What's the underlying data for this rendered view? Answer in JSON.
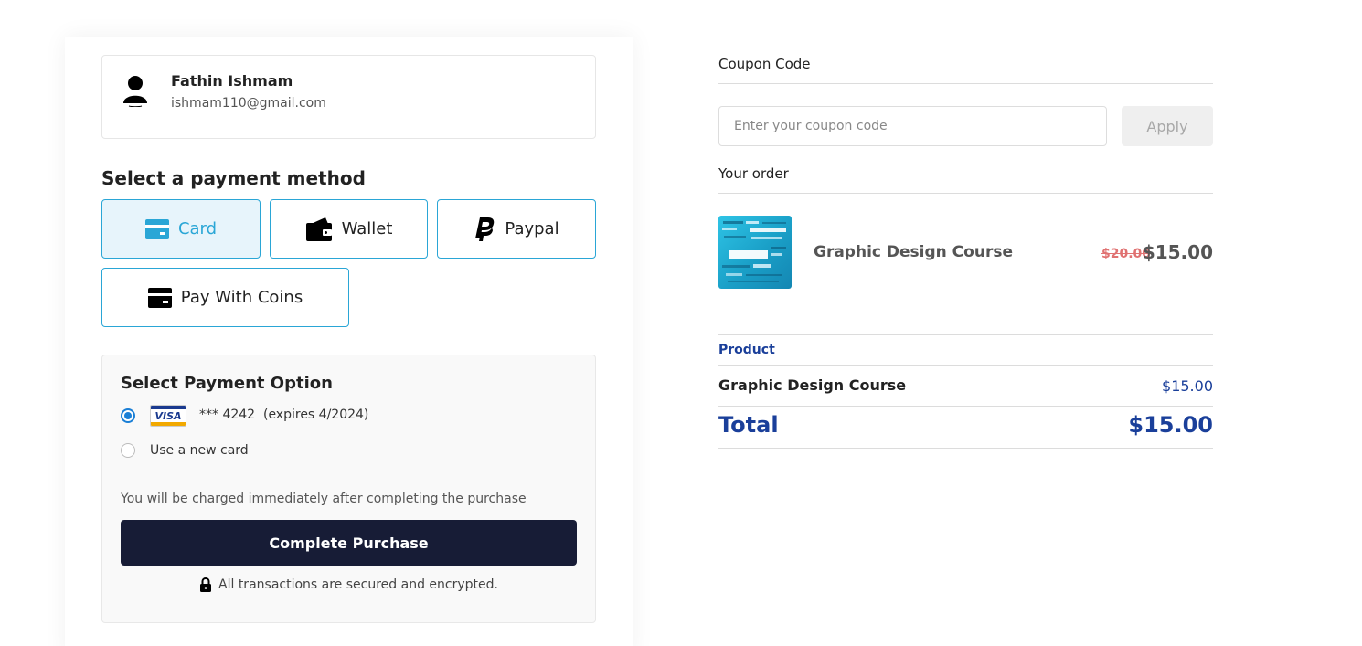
{
  "user": {
    "name": "Fathin Ishmam",
    "email": "ishmam110@gmail.com"
  },
  "payment_methods": {
    "title": "Select a payment method",
    "items": [
      {
        "label": "Card",
        "icon": "credit-card-icon",
        "active": true
      },
      {
        "label": "Wallet",
        "icon": "wallet-icon",
        "active": false
      },
      {
        "label": "Paypal",
        "icon": "paypal-icon",
        "active": false
      },
      {
        "label": "Pay With Coins",
        "icon": "coins-card-icon",
        "active": false
      }
    ]
  },
  "payment_option": {
    "title": "Select Payment Option",
    "saved_card": {
      "brand": "VISA",
      "info": "*** 4242  (expires 4/2024)",
      "selected": true
    },
    "new_card_label": "Use a new card",
    "charge_note": "You will be charged immediately after completing the purchase",
    "complete_label": "Complete Purchase",
    "secure_note": "All transactions are secured and encrypted."
  },
  "coupon": {
    "label": "Coupon Code",
    "placeholder": "Enter your coupon code",
    "apply_label": "Apply"
  },
  "order": {
    "title": "Your order",
    "course_name": "Graphic Design Course",
    "old_price": "$20.00",
    "new_price": "$15.00"
  },
  "summary": {
    "product_header": "Product",
    "rows": [
      {
        "name": "Graphic Design Course",
        "price": "$15.00"
      }
    ],
    "total_label": "Total",
    "total_value": "$15.00"
  },
  "colors": {
    "accent": "#2aa6d6",
    "primary_dark": "#171c36",
    "link_blue": "#1a3f9a",
    "strike_red": "#e07272"
  }
}
